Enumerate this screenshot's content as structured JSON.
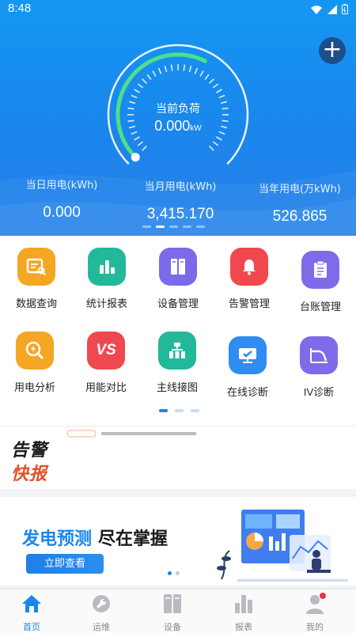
{
  "status_bar": {
    "time": "8:48"
  },
  "gauge": {
    "label": "当前负荷",
    "value": "0.000",
    "unit": "kW",
    "arc_fill_fraction": 0.6
  },
  "stats": [
    {
      "label": "当日用电(kWh)",
      "value": "0.000"
    },
    {
      "label": "当月用电(kWh)",
      "value": "3,415.170"
    },
    {
      "label": "当年用电(万kWh)",
      "value": "526.865"
    }
  ],
  "menu": [
    {
      "label": "数据查询",
      "icon": "data-query-icon",
      "color": "#f5a623"
    },
    {
      "label": "统计报表",
      "icon": "statistics-report-icon",
      "color": "#22b89a"
    },
    {
      "label": "设备管理",
      "icon": "device-management-icon",
      "color": "#7b6bea"
    },
    {
      "label": "告警管理",
      "icon": "alarm-bell-icon",
      "color": "#f0484f"
    },
    {
      "label": "台账管理",
      "icon": "ledger-icon",
      "color": "#7e6bea"
    },
    {
      "label": "用电分析",
      "icon": "power-analysis-icon",
      "color": "#f5a623"
    },
    {
      "label": "用能对比",
      "icon": "energy-compare-icon",
      "color": "#f0484f"
    },
    {
      "label": "主线接图",
      "icon": "wiring-diagram-icon",
      "color": "#22b89a"
    },
    {
      "label": "在线诊断",
      "icon": "online-diagnosis-icon",
      "color": "#2f8cf0"
    },
    {
      "label": "IV诊断",
      "icon": "iv-curve-icon",
      "color": "#7e6bea"
    }
  ],
  "alert": {
    "logo_line1": "告警",
    "logo_line2": "快报"
  },
  "banner": {
    "title_highlight": "发电预测",
    "title_rest": "尽在掌握",
    "button_label": "立即查看"
  },
  "tabbar": [
    {
      "label": "首页",
      "icon": "home-icon",
      "active": true
    },
    {
      "label": "运维",
      "icon": "wrench-icon",
      "active": false
    },
    {
      "label": "设备",
      "icon": "device-icon",
      "active": false
    },
    {
      "label": "报表",
      "icon": "report-icon",
      "active": false
    },
    {
      "label": "我的",
      "icon": "user-icon",
      "active": false
    }
  ],
  "colors": {
    "primary": "#1a86ec",
    "hero_top": "#1497f2",
    "gauge_arc": "#4de08a",
    "alert_red": "#e0522a"
  }
}
